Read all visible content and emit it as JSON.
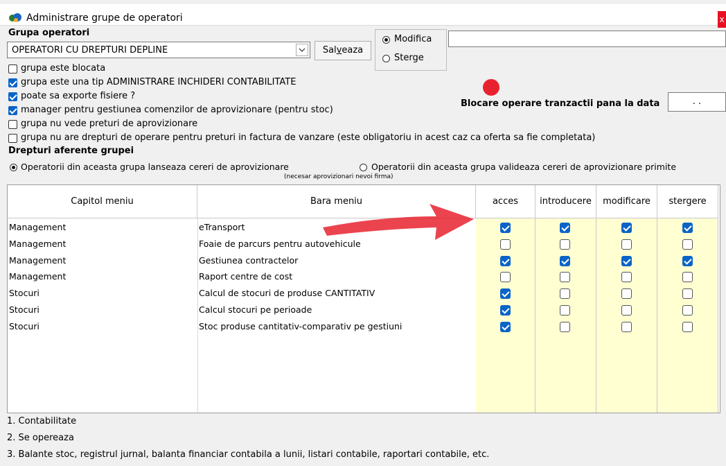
{
  "window": {
    "title": "Administrare grupe de operatori",
    "close": "x"
  },
  "group_section": {
    "label": "Grupa operatori",
    "selected_group": "OPERATORI CU DREPTURI DEPLINE",
    "save_label_pre": "Sal",
    "save_label_u": "v",
    "save_label_post": "eaza",
    "mode_modify": "Modifica",
    "mode_delete": "Sterge",
    "mode_selected": "modify",
    "name_input_value": ""
  },
  "options": [
    {
      "label": "grupa este blocata",
      "checked": false
    },
    {
      "label": "grupa este una tip ADMINISTRARE INCHIDERI CONTABILITATE",
      "checked": true
    },
    {
      "label": "poate sa exporte fisiere ?",
      "checked": true
    },
    {
      "label": "manager pentru gestiunea comenzilor de aprovizionare (pentru stoc)",
      "checked": true
    },
    {
      "label": "grupa nu vede preturi de aprovizionare",
      "checked": false
    },
    {
      "label": "grupa nu are drepturi de operare pentru preturi in factura de vanzare (este obligatoriu in acest caz ca oferta sa fie completata)",
      "checked": false
    }
  ],
  "blocking": {
    "label": "Blocare operare tranzactii pana la data",
    "date_value": ". ."
  },
  "rights": {
    "heading": "Drepturi aferente grupei",
    "radio_launch": "Operatorii din aceasta grupa lanseaza cereri de aprovizionare",
    "radio_launch_note": "(necesar aprovizionari nevoi firma)",
    "radio_validate": "Operatorii din aceasta grupa valideaza cereri de aprovizionare primite",
    "selected": "launch"
  },
  "table": {
    "columns": [
      "Capitol meniu",
      "Bara meniu",
      "acces",
      "introducere",
      "modificare",
      "stergere"
    ],
    "rows": [
      {
        "capitol": "Management",
        "bara": "eTransport",
        "acces": true,
        "introducere": true,
        "modificare": true,
        "stergere": true
      },
      {
        "capitol": "Management",
        "bara": "Foaie de parcurs pentru autovehicule",
        "acces": false,
        "introducere": false,
        "modificare": false,
        "stergere": false
      },
      {
        "capitol": "Management",
        "bara": "Gestiunea contractelor",
        "acces": true,
        "introducere": true,
        "modificare": true,
        "stergere": true
      },
      {
        "capitol": "Management",
        "bara": "Raport centre de cost",
        "acces": false,
        "introducere": false,
        "modificare": false,
        "stergere": false
      },
      {
        "capitol": "Stocuri",
        "bara": "Calcul de stocuri de produse CANTITATIV",
        "acces": true,
        "introducere": false,
        "modificare": false,
        "stergere": false
      },
      {
        "capitol": "Stocuri",
        "bara": "Calcul stocuri pe perioade",
        "acces": true,
        "introducere": false,
        "modificare": false,
        "stergere": false
      },
      {
        "capitol": "Stocuri",
        "bara": "Stoc produse cantitativ-comparativ pe gestiuni",
        "acces": true,
        "introducere": false,
        "modificare": false,
        "stergere": false
      }
    ]
  },
  "footer": [
    "1. Contabilitate",
    "2. Se opereaza",
    "3. Balante stoc, registrul jurnal, balanta financiar contabila a lunii, listari contabile, raportari contabile, etc."
  ],
  "colors": {
    "accent": "#0a64c8",
    "annotation": "#e8232f",
    "grid_highlight": "#ffffd2"
  }
}
